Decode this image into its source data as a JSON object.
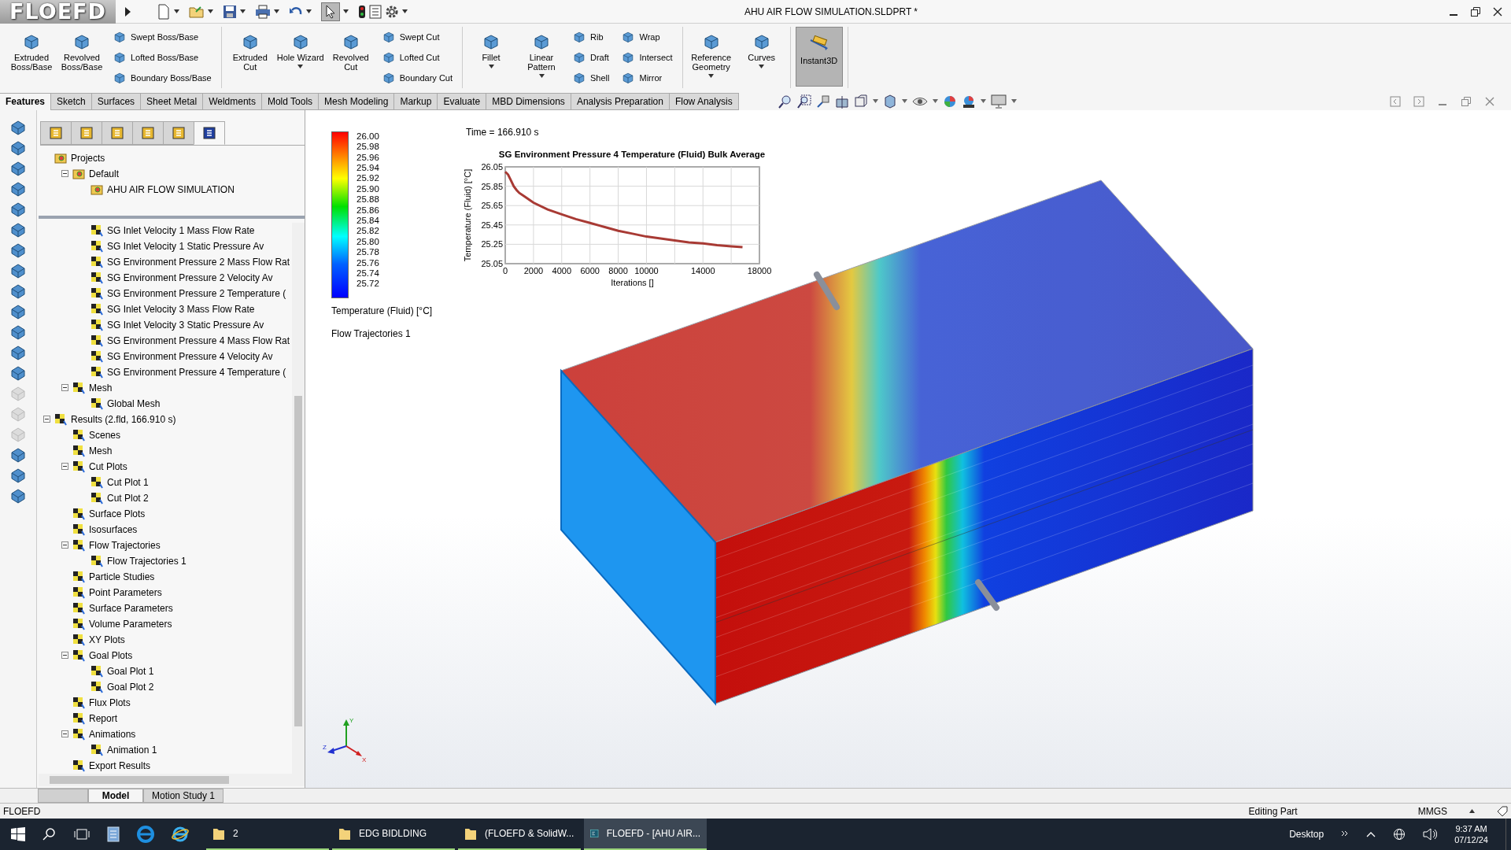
{
  "app": {
    "logo": "FLOEFD",
    "title": "AHU AIR FLOW SIMULATION.SLDPRT *",
    "select_tool": {
      "selected": true
    }
  },
  "ribbon": [
    {
      "items": [
        {
          "kind": "large",
          "label": "Extruded Boss/Base",
          "dropdown": false
        },
        {
          "kind": "large",
          "label": "Revolved Boss/Base",
          "dropdown": false
        },
        {
          "kind": "stack",
          "labels": [
            "Swept Boss/Base",
            "Lofted Boss/Base",
            "Boundary Boss/Base"
          ]
        }
      ]
    },
    {
      "items": [
        {
          "kind": "large",
          "label": "Extruded Cut",
          "dropdown": false
        },
        {
          "kind": "large",
          "label": "Hole Wizard",
          "dropdown": true
        },
        {
          "kind": "large",
          "label": "Revolved Cut",
          "dropdown": false
        },
        {
          "kind": "stack",
          "labels": [
            "Swept Cut",
            "Lofted Cut",
            "Boundary Cut"
          ]
        }
      ]
    },
    {
      "items": [
        {
          "kind": "large",
          "label": "Fillet",
          "dropdown": true
        },
        {
          "kind": "large",
          "label": "Linear Pattern",
          "dropdown": true
        },
        {
          "kind": "stack",
          "labels": [
            "Rib",
            "Draft",
            "Shell"
          ]
        },
        {
          "kind": "stack",
          "labels": [
            "Wrap",
            "Intersect",
            "Mirror"
          ]
        }
      ]
    },
    {
      "items": [
        {
          "kind": "large",
          "label": "Reference Geometry",
          "dropdown": true
        },
        {
          "kind": "large",
          "label": "Curves",
          "dropdown": true
        }
      ]
    },
    {
      "items": [
        {
          "kind": "toggle",
          "label": "Instant3D",
          "selected": true
        }
      ]
    }
  ],
  "tabs": [
    {
      "label": "Features",
      "selected": true
    },
    {
      "label": "Sketch",
      "selected": false
    },
    {
      "label": "Surfaces",
      "selected": false
    },
    {
      "label": "Sheet Metal",
      "selected": false
    },
    {
      "label": "Weldments",
      "selected": false
    },
    {
      "label": "Mold Tools",
      "selected": false
    },
    {
      "label": "Mesh Modeling",
      "selected": false
    },
    {
      "label": "Markup",
      "selected": false
    },
    {
      "label": "Evaluate",
      "selected": false
    },
    {
      "label": "MBD Dimensions",
      "selected": false
    },
    {
      "label": "Analysis Preparation",
      "selected": false
    },
    {
      "label": "Flow Analysis",
      "selected": false
    }
  ],
  "left_tools": [
    {
      "disabled": false
    },
    {
      "disabled": false
    },
    {
      "disabled": false
    },
    {
      "disabled": false
    },
    {
      "disabled": false
    },
    {
      "disabled": false
    },
    {
      "disabled": false
    },
    {
      "disabled": false
    },
    {
      "disabled": false
    },
    {
      "disabled": false
    },
    {
      "disabled": false
    },
    {
      "disabled": false
    },
    {
      "disabled": false
    },
    {
      "disabled": true
    },
    {
      "disabled": true
    },
    {
      "disabled": true
    },
    {
      "disabled": false
    },
    {
      "disabled": false
    },
    {
      "disabled": false
    }
  ],
  "panel_tabs": [
    {
      "selected": false
    },
    {
      "selected": false
    },
    {
      "selected": false
    },
    {
      "selected": false
    },
    {
      "selected": false
    },
    {
      "selected": true
    }
  ],
  "upper_tree": [
    {
      "label": "Projects",
      "children": [
        {
          "label": "Default",
          "expanded": true,
          "children": [
            {
              "label": "AHU AIR FLOW SIMULATION"
            }
          ]
        }
      ]
    }
  ],
  "lower_tree": {
    "goal_entries": [
      "SG Inlet Velocity 1 Mass Flow Rate",
      "SG Inlet Velocity 1 Static Pressure Av",
      "SG Environment Pressure 2 Mass Flow Rat",
      "SG Environment Pressure 2 Velocity Av",
      "SG Environment Pressure 2 Temperature (",
      "SG Inlet Velocity 3 Mass Flow Rate",
      "SG Inlet Velocity 3 Static Pressure Av",
      "SG Environment Pressure 4 Mass Flow Rat",
      "SG Environment Pressure 4 Velocity Av",
      "SG Environment Pressure 4 Temperature ("
    ],
    "input_items": [
      {
        "label": "Mesh",
        "expanded": true,
        "children": [
          {
            "label": "Global Mesh"
          }
        ]
      }
    ],
    "results": [
      {
        "label": "Results (2.fld, 166.910 s)",
        "expanded": true,
        "children": [
          {
            "label": "Scenes"
          },
          {
            "label": "Mesh"
          },
          {
            "label": "Cut Plots",
            "expanded": true,
            "children": [
              {
                "label": "Cut Plot 1"
              },
              {
                "label": "Cut Plot 2"
              }
            ]
          },
          {
            "label": "Surface Plots"
          },
          {
            "label": "Isosurfaces"
          },
          {
            "label": "Flow Trajectories",
            "expanded": true,
            "children": [
              {
                "label": "Flow Trajectories 1"
              }
            ]
          },
          {
            "label": "Particle Studies"
          },
          {
            "label": "Point Parameters"
          },
          {
            "label": "Surface Parameters"
          },
          {
            "label": "Volume Parameters"
          },
          {
            "label": "XY Plots"
          },
          {
            "label": "Goal Plots",
            "expanded": true,
            "children": [
              {
                "label": "Goal Plot 1"
              },
              {
                "label": "Goal Plot 2"
              }
            ]
          },
          {
            "label": "Flux Plots"
          },
          {
            "label": "Report"
          },
          {
            "label": "Animations",
            "expanded": true,
            "children": [
              {
                "label": "Animation 1"
              }
            ]
          },
          {
            "label": "Export Results"
          }
        ]
      }
    ]
  },
  "bottom_tabs": [
    {
      "label": "Model",
      "selected": true
    },
    {
      "label": "Motion Study 1",
      "selected": false
    }
  ],
  "viewport": {
    "time": "Time = 166.910 s",
    "legend": {
      "values": [
        "26.00",
        "25.98",
        "25.96",
        "25.94",
        "25.92",
        "25.90",
        "25.88",
        "25.86",
        "25.84",
        "25.82",
        "25.80",
        "25.78",
        "25.76",
        "25.74",
        "25.72"
      ],
      "title": "Temperature (Fluid) [°C]",
      "plot_name": "Flow Trajectories 1"
    },
    "chart_data": {
      "type": "line",
      "title": "SG Environment Pressure 4 Temperature (Fluid) Bulk Average",
      "xlabel": "Iterations []",
      "ylabel": "Temperature (Fluid) [°C]",
      "x": [
        0,
        200,
        400,
        600,
        800,
        1000,
        1400,
        2000,
        3000,
        4000,
        5000,
        6000,
        7000,
        8000,
        9000,
        10000,
        11000,
        12000,
        13000,
        14000,
        15000,
        16000,
        16800
      ],
      "series": [
        {
          "color": "#a83a34",
          "values": [
            26.0,
            25.97,
            25.91,
            25.85,
            25.81,
            25.78,
            25.74,
            25.68,
            25.61,
            25.56,
            25.51,
            25.47,
            25.43,
            25.39,
            25.36,
            25.33,
            25.31,
            25.29,
            25.27,
            25.26,
            25.24,
            25.23,
            25.22
          ]
        }
      ],
      "grid": true,
      "xlim": [
        0,
        18000
      ],
      "ylim": [
        25.05,
        26.05
      ],
      "xticks": [
        0,
        2000,
        4000,
        6000,
        8000,
        10000,
        14000,
        18000
      ],
      "yticks": [
        25.05,
        25.25,
        25.45,
        25.65,
        25.85,
        26.05
      ]
    },
    "triad": [
      "Y",
      "Z",
      "X"
    ]
  },
  "status_bar": {
    "app": "FLOEFD",
    "mode": "Editing Part",
    "units": "MMGS"
  },
  "taskbar": {
    "items": [
      {
        "label": "2",
        "active": false
      },
      {
        "label": "EDG BIDLDING",
        "active": false
      },
      {
        "label": "(FLOEFD & SolidW...",
        "active": false
      },
      {
        "label": "FLOEFD - [AHU AIR...",
        "active": true
      }
    ],
    "desktop": "Desktop",
    "time": "9:37 AM",
    "date": "07/12/24"
  }
}
